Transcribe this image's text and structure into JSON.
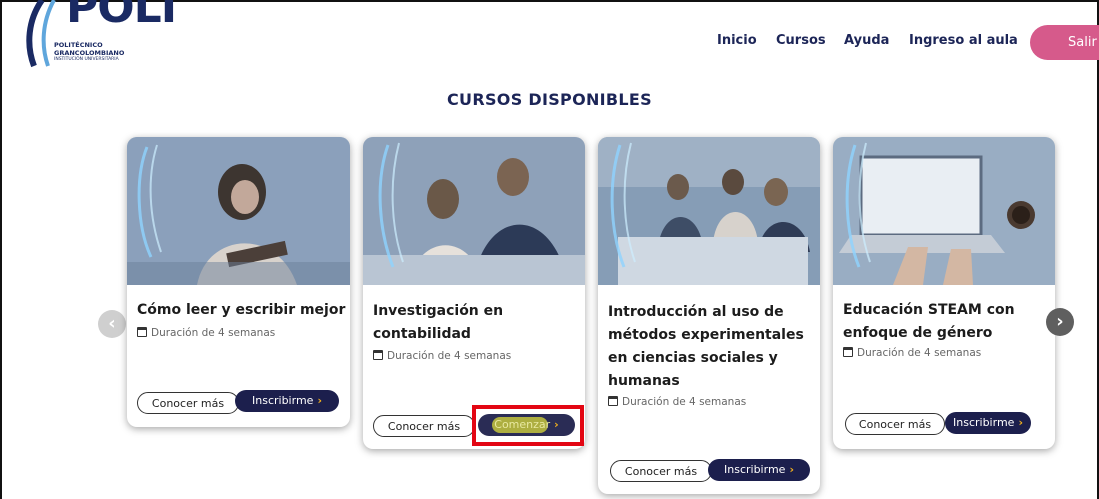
{
  "brand": {
    "logo_text": "POLI",
    "line1": "POLITÉCNICO",
    "line2": "GRANCOLOMBIANO",
    "line3": "INSTITUCIÓN UNIVERSITARIA",
    "primary_color": "#1a2a63",
    "accent_color": "#d65a8b"
  },
  "nav": {
    "items": [
      "Inicio",
      "Cursos",
      "Ayuda",
      "Ingreso al aula"
    ],
    "logout_label": "Salir"
  },
  "section_title": "CURSOS DISPONIBLES",
  "cards": [
    {
      "title_lines": [
        "Cómo leer y escribir mejor"
      ],
      "duration": "Duración de 4 semanas",
      "secondary_label": "Conocer más",
      "primary_label": "Inscribirme",
      "primary_icon": "chevron-right-icon"
    },
    {
      "title_lines": [
        "Investigación en",
        "contabilidad"
      ],
      "duration": "Duración de 4 semanas",
      "secondary_label": "Conocer más",
      "primary_label": "Comenzar",
      "primary_icon": "chevron-right-icon"
    },
    {
      "title_lines": [
        "Introducción al uso de",
        "métodos experimentales",
        "en ciencias sociales y",
        "humanas"
      ],
      "duration": "Duración de 4 semanas",
      "secondary_label": "Conocer más",
      "primary_label": "Inscribirme",
      "primary_icon": "chevron-right-icon"
    },
    {
      "title_lines": [
        "Educación STEAM con",
        "enfoque de género"
      ],
      "duration": "Duración de 4 semanas",
      "secondary_label": "Conocer más",
      "primary_label": "Inscribirme",
      "primary_icon": "chevron-right-icon"
    }
  ],
  "carousel": {
    "prev_icon": "chevron-left-icon",
    "next_icon": "chevron-right-icon",
    "prev_symbol": "‹",
    "next_symbol": "›"
  },
  "annotation": {
    "highlight_color": "#e30613",
    "target": "Comenzar"
  }
}
